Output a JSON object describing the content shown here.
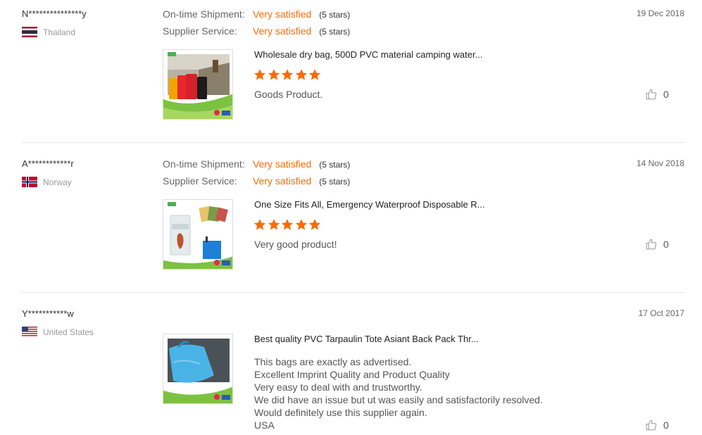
{
  "labels": {
    "ontime_shipment": "On-time Shipment:",
    "supplier_service": "Supplier Service:"
  },
  "colors": {
    "accent": "#ff6a00",
    "star": "#ff6a00",
    "divider": "#e5e5e5"
  },
  "reviews": [
    {
      "buyer": "N***************y",
      "country": "Thailand",
      "flag_icon": "thailand-flag-icon",
      "date": "19 Dec 2018",
      "ontime_value": "Very satisfied",
      "ontime_stars": "(5 stars)",
      "service_value": "Very satisfied",
      "service_stars": "(5 stars)",
      "product_title": "Wholesale dry bag, 500D PVC material camping water...",
      "rating": 5,
      "comment": [
        "Goods Product."
      ],
      "likes": "0"
    },
    {
      "buyer": "A************r",
      "country": "Norway",
      "flag_icon": "norway-flag-icon",
      "date": "14 Nov 2018",
      "ontime_value": "Very satisfied",
      "ontime_stars": "(5 stars)",
      "service_value": "Very satisfied",
      "service_stars": "(5 stars)",
      "product_title": "One Size Fits All, Emergency Waterproof Disposable R...",
      "rating": 5,
      "comment": [
        "Very good product!"
      ],
      "likes": "0"
    },
    {
      "buyer": "Y***********w",
      "country": "United States",
      "flag_icon": "us-flag-icon",
      "date": "17 Oct 2017",
      "product_title": "Best quality PVC Tarpaulin Tote Asiant Back Pack Thr...",
      "comment": [
        "This bags are exactly as advertised.",
        "Excellent Imprint Quality and Product Quality",
        "Very easy to deal with and trustworthy.",
        "We did have an issue but ut was easily and satisfactorily resolved.",
        "Would definitely use this supplier again.",
        "USA"
      ],
      "likes": "0"
    }
  ]
}
